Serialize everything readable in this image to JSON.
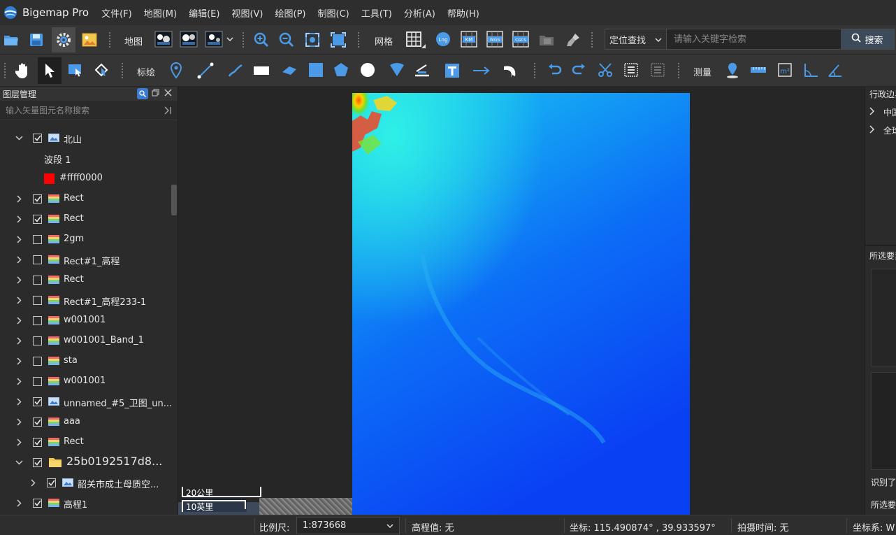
{
  "app": {
    "name": "Bigemap Pro"
  },
  "menu": [
    "文件(F)",
    "地图(M)",
    "编辑(E)",
    "视图(V)",
    "绘图(P)",
    "制图(C)",
    "工具(T)",
    "分析(A)",
    "帮助(H)"
  ],
  "toolbar1": {
    "map_label": "地图",
    "grid_label": "网格",
    "grid_labels": [
      "Lng",
      "KM",
      "WGS",
      "CGCS"
    ],
    "locate_mode": "定位查找",
    "search_placeholder": "请输入关键字检索",
    "search_button": "搜索"
  },
  "toolbar2": {
    "annotate_label": "标绘",
    "measure_label": "测量"
  },
  "layer_panel": {
    "title": "图层管理",
    "search_placeholder": "输入矢量图元名称搜索",
    "rows": [
      {
        "name": "北山",
        "level": 0,
        "expanded": true,
        "checked": true,
        "icon": "image"
      },
      {
        "name": "波段 1",
        "level": 1,
        "type": "text"
      },
      {
        "name": "#ffff0000",
        "level": 1,
        "type": "swatch",
        "color": "#ff0000"
      },
      {
        "name": "Rect",
        "level": 0,
        "checked": true,
        "icon": "raster"
      },
      {
        "name": "Rect",
        "level": 0,
        "checked": true,
        "icon": "raster"
      },
      {
        "name": "2gm",
        "level": 0,
        "checked": false,
        "icon": "raster"
      },
      {
        "name": "Rect#1_高程",
        "level": 0,
        "checked": false,
        "icon": "raster"
      },
      {
        "name": "Rect",
        "level": 0,
        "checked": false,
        "icon": "raster"
      },
      {
        "name": "Rect#1_高程233-1",
        "level": 0,
        "checked": false,
        "icon": "raster"
      },
      {
        "name": "w001001",
        "level": 0,
        "checked": false,
        "icon": "raster"
      },
      {
        "name": "w001001_Band_1",
        "level": 0,
        "checked": false,
        "icon": "raster"
      },
      {
        "name": "sta",
        "level": 0,
        "checked": false,
        "icon": "raster"
      },
      {
        "name": "w001001",
        "level": 0,
        "checked": false,
        "icon": "raster"
      },
      {
        "name": "unnamed_#5_卫图_un...",
        "level": 0,
        "checked": true,
        "icon": "image"
      },
      {
        "name": "aaa",
        "level": 0,
        "checked": true,
        "icon": "raster"
      },
      {
        "name": "Rect",
        "level": 0,
        "checked": true,
        "icon": "raster"
      },
      {
        "name": "25b0192517d8...",
        "level": 0,
        "expanded": true,
        "checked": true,
        "icon": "folder"
      },
      {
        "name": "韶关市成土母质空...",
        "level": 1,
        "checked": true,
        "icon": "image"
      },
      {
        "name": "高程1",
        "level": 0,
        "checked": true,
        "icon": "raster"
      }
    ]
  },
  "map": {
    "scale_km": "20公里",
    "scale_mi": "10英里"
  },
  "right_panel": {
    "title1": "行政边界",
    "items": [
      "中国",
      "全球"
    ],
    "title2": "所选要素",
    "text1": "识别了",
    "text2": "所选要"
  },
  "status": {
    "scale_label": "比例尺:",
    "scale_value": "1:873668",
    "elevation": "高程值: 无",
    "coords": "坐标: 115.490874° , 39.933597°",
    "capture_time": "拍摄时间: 无",
    "crs": "坐标系: W"
  }
}
